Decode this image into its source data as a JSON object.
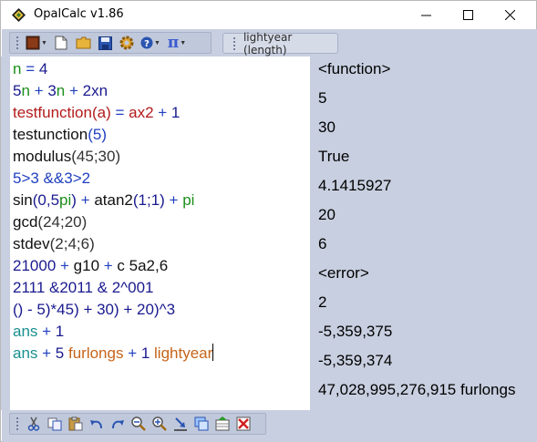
{
  "window": {
    "title": "OpalCalc v1.86",
    "minimize_glyph": "—",
    "maximize_glyph": "☐",
    "close_glyph": "✕"
  },
  "toolbar": {
    "buttons": [
      "color-theme-icon",
      "new-document-icon",
      "open-folder-icon",
      "save-icon",
      "settings-gear-icon",
      "help-icon",
      "pi-constants-icon"
    ],
    "pi_glyph": "π",
    "help_glyph": "?"
  },
  "tabs": [
    {
      "label": "lightyear (length)"
    }
  ],
  "editor": {
    "lines": [
      [
        {
          "t": "n",
          "c": "#1a8f1a"
        },
        {
          "t": " = ",
          "c": "#1f3fbf"
        },
        {
          "t": "4",
          "c": "#1a1a8f"
        }
      ],
      [
        {
          "t": "5",
          "c": "#1a1a8f"
        },
        {
          "t": "n",
          "c": "#1a8f1a"
        },
        {
          "t": " + ",
          "c": "#1f3fbf"
        },
        {
          "t": "3",
          "c": "#1a1a8f"
        },
        {
          "t": "n",
          "c": "#1a8f1a"
        },
        {
          "t": " + ",
          "c": "#1f3fbf"
        },
        {
          "t": "2xn",
          "c": "#1a1a8f"
        }
      ],
      [
        {
          "t": "testfunction",
          "c": "#b31b1b"
        },
        {
          "t": "(a)",
          "c": "#b31b1b"
        },
        {
          "t": " = ",
          "c": "#1f3fbf"
        },
        {
          "t": "ax2",
          "c": "#b31b1b"
        },
        {
          "t": " + ",
          "c": "#1f3fbf"
        },
        {
          "t": "1",
          "c": "#1a1a8f"
        }
      ],
      [
        {
          "t": "testunction",
          "c": "#111111"
        },
        {
          "t": "(5)",
          "c": "#1f3fbf"
        }
      ],
      [
        {
          "t": "modulus",
          "c": "#111111"
        },
        {
          "t": "(45;30)",
          "c": "#333333"
        }
      ],
      [
        {
          "t": "5>3 &&3>2",
          "c": "#1f3fbf"
        }
      ],
      [
        {
          "t": "sin",
          "c": "#111111"
        },
        {
          "t": "(0,5",
          "c": "#1a1a8f"
        },
        {
          "t": "pi",
          "c": "#1a8f1a"
        },
        {
          "t": ")",
          "c": "#1a1a8f"
        },
        {
          "t": " + ",
          "c": "#1f3fbf"
        },
        {
          "t": "atan2",
          "c": "#111111"
        },
        {
          "t": "(1;1)",
          "c": "#1a1a8f"
        },
        {
          "t": " + ",
          "c": "#1f3fbf"
        },
        {
          "t": "pi",
          "c": "#1a8f1a"
        }
      ],
      [
        {
          "t": "gcd",
          "c": "#111111"
        },
        {
          "t": "(24;20)",
          "c": "#333333"
        }
      ],
      [
        {
          "t": "stdev",
          "c": "#111111"
        },
        {
          "t": "(2;4;6)",
          "c": "#333333"
        }
      ],
      [
        {
          "t": "21000",
          "c": "#1a1a8f"
        },
        {
          "t": " + ",
          "c": "#1f3fbf"
        },
        {
          "t": "g10",
          "c": "#111111"
        },
        {
          "t": " + ",
          "c": "#1f3fbf"
        },
        {
          "t": "c 5a2,6",
          "c": "#111111"
        }
      ],
      [
        {
          "t": "2111 &2011 & 2^001",
          "c": "#1a1a8f"
        }
      ],
      [
        {
          "t": "() - 5)*45) + 30) + 20)^3",
          "c": "#1a1a8f"
        }
      ],
      [
        {
          "t": "ans",
          "c": "#1a8f8f"
        },
        {
          "t": " + ",
          "c": "#1f3fbf"
        },
        {
          "t": "1",
          "c": "#1a1a8f"
        }
      ],
      [
        {
          "t": "ans",
          "c": "#1a8f8f"
        },
        {
          "t": " + ",
          "c": "#1f3fbf"
        },
        {
          "t": "5 ",
          "c": "#1a1a8f"
        },
        {
          "t": "furlongs",
          "c": "#c7641a"
        },
        {
          "t": " + ",
          "c": "#1f3fbf"
        },
        {
          "t": "1 ",
          "c": "#1a1a8f"
        },
        {
          "t": "lightyear",
          "c": "#c7641a"
        }
      ]
    ]
  },
  "results": [
    "<function>",
    "5",
    "30",
    "True",
    "4.1415927",
    "20",
    "6",
    "<error>",
    "2",
    "-5,359,375",
    "-5,359,374",
    "47,028,995,276,915 furlongs"
  ],
  "bottom_toolbar": {
    "buttons": [
      "cut-icon",
      "copy-icon",
      "paste-icon",
      "undo-icon",
      "redo-icon",
      "zoom-out-icon",
      "zoom-in-icon",
      "insert-answer-icon",
      "copy-window-icon",
      "export-icon",
      "clear-icon"
    ]
  },
  "colors": {
    "frame": "#c8cfe0",
    "results_bg": "#c8cfe0",
    "editor_bg": "#ffffff"
  }
}
